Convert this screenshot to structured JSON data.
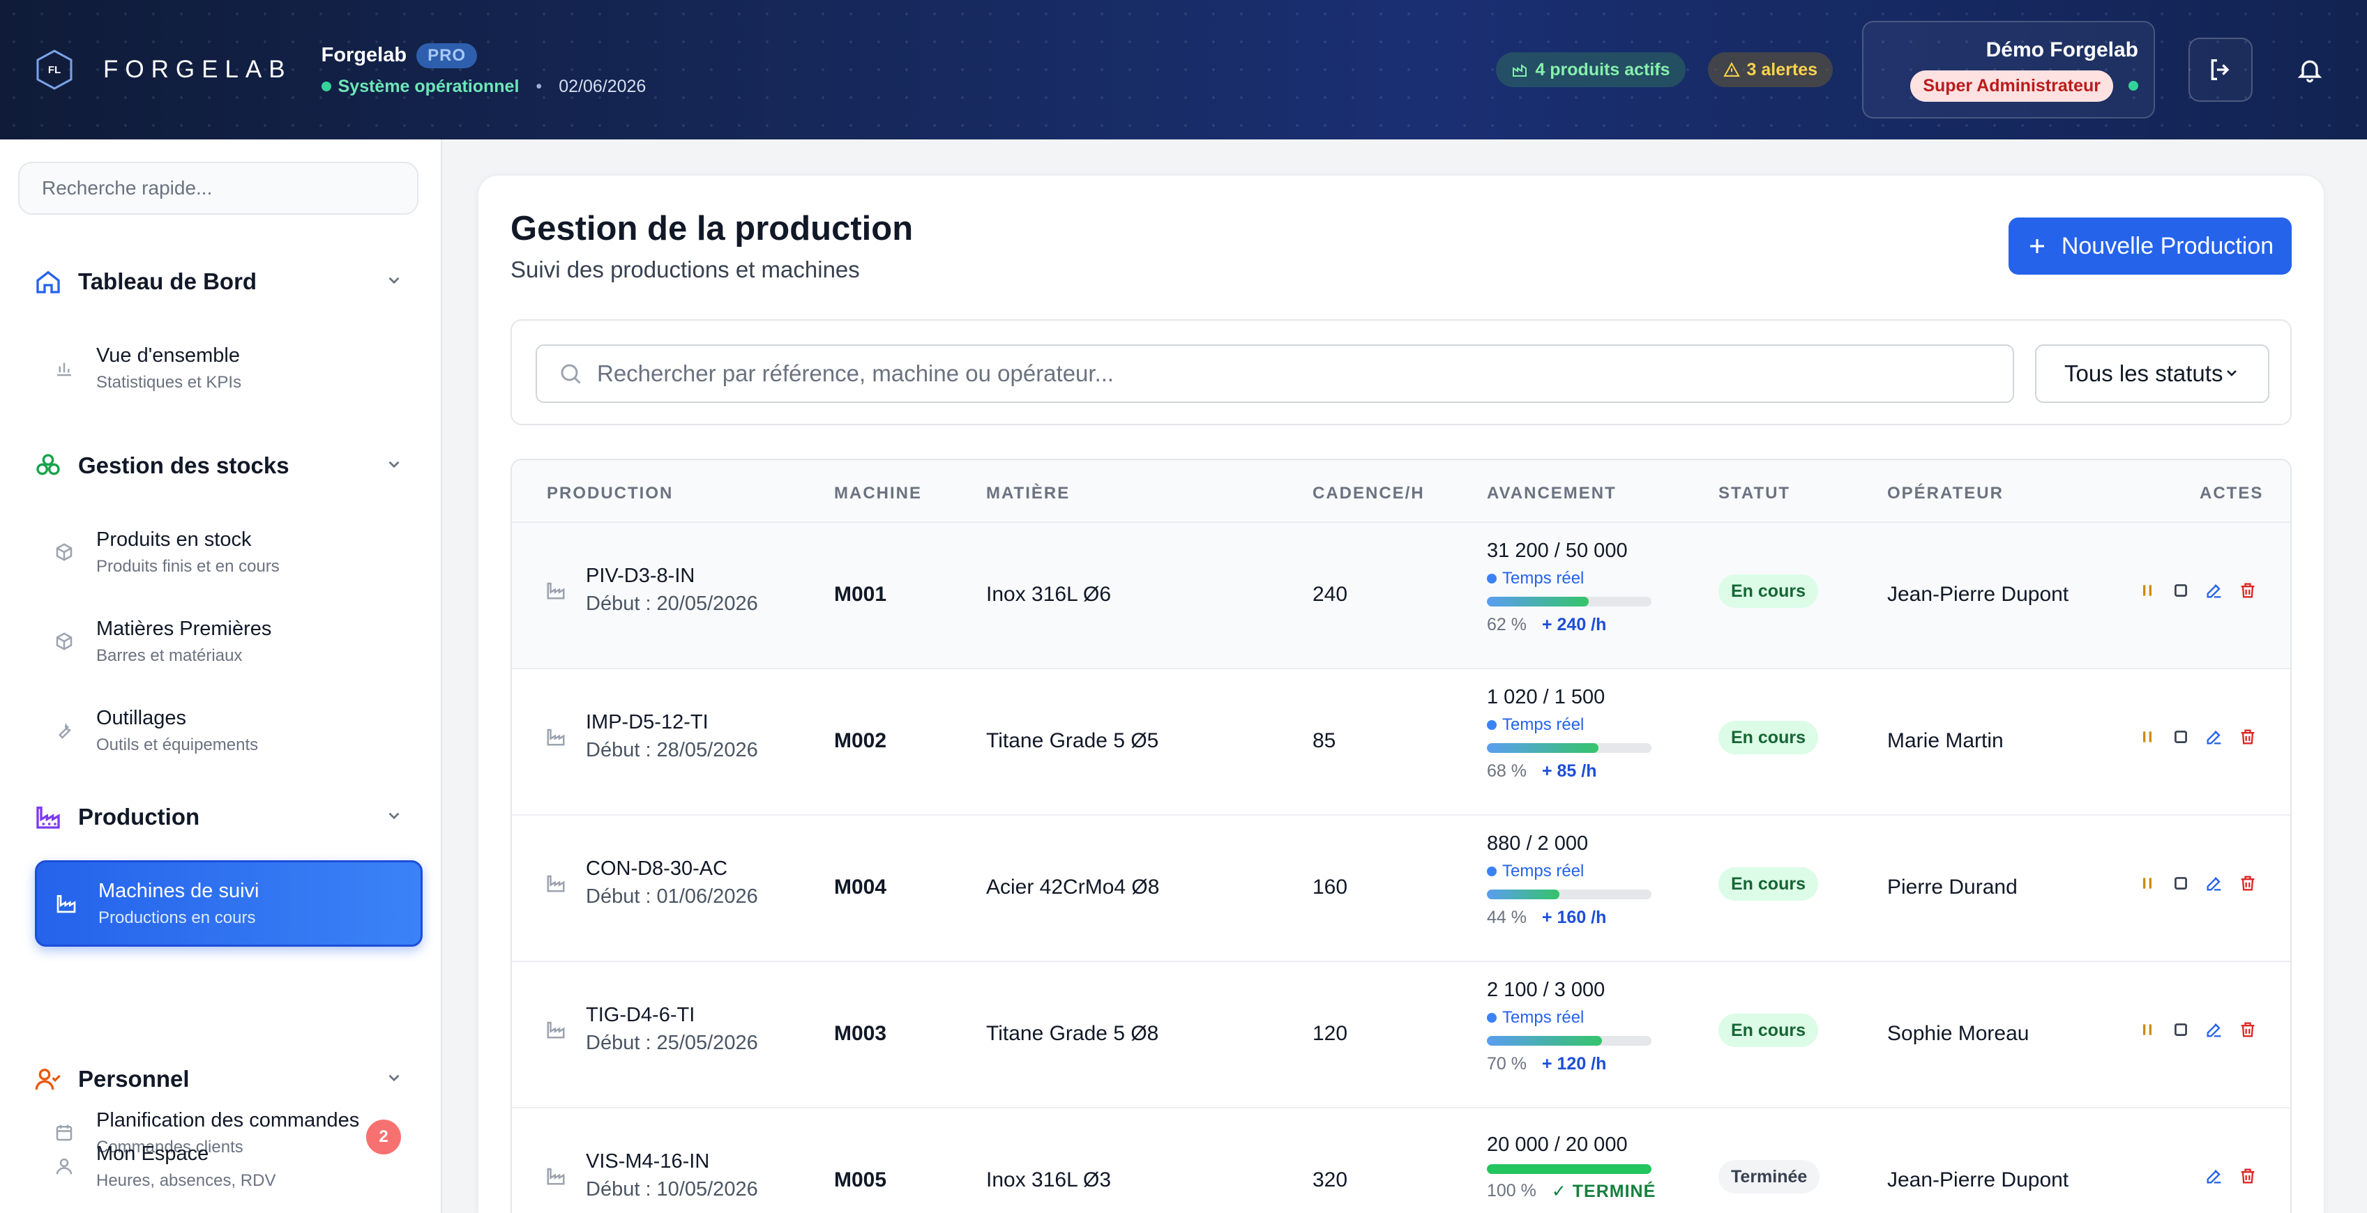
{
  "header": {
    "logo_mark": "FL",
    "logo_text": "FORGELAB",
    "org_name": "Forgelab",
    "plan_badge": "PRO",
    "system_status": "Système opérationnel",
    "separator": "•",
    "date": "02/06/2026",
    "active_products": "4 produits actifs",
    "alerts": "3 alertes",
    "user_name": "Démo Forgelab",
    "user_role": "Super Administrateur"
  },
  "sidebar": {
    "search_placeholder": "Recherche rapide...",
    "sections": [
      {
        "label": "Tableau de Bord",
        "icon": "home-icon",
        "color": "#2563eb"
      },
      {
        "label": "Gestion des stocks",
        "icon": "boxes-icon",
        "color": "#16a34a"
      },
      {
        "label": "Production",
        "icon": "factory-icon",
        "color": "#7c3aed"
      },
      {
        "label": "Personnel",
        "icon": "user-check-icon",
        "color": "#ea580c"
      }
    ],
    "items": [
      {
        "title": "Vue d'ensemble",
        "subtitle": "Statistiques et KPIs",
        "icon": "bar-chart-icon"
      },
      {
        "title": "Produits en stock",
        "subtitle": "Produits finis et en cours",
        "icon": "package-icon"
      },
      {
        "title": "Matières Premières",
        "subtitle": "Barres et matériaux",
        "icon": "package-icon"
      },
      {
        "title": "Outillages",
        "subtitle": "Outils et équipements",
        "icon": "wrench-icon"
      },
      {
        "title": "Machines de suivi",
        "subtitle": "Productions en cours",
        "icon": "factory-icon",
        "active": true
      },
      {
        "title": "Planification des commandes",
        "subtitle": "Commandes clients",
        "icon": "calendar-icon",
        "badge": "2"
      },
      {
        "title": "Mon Espace",
        "subtitle": "Heures, absences, RDV",
        "icon": "user-icon"
      }
    ]
  },
  "main": {
    "title": "Gestion de la production",
    "subtitle": "Suivi des productions et machines",
    "new_button": "Nouvelle Production",
    "search_placeholder": "Rechercher par référence, machine ou opérateur...",
    "status_filter": "Tous les statuts",
    "columns": [
      "PRODUCTION",
      "MACHINE",
      "MATIÈRE",
      "CADENCE/H",
      "AVANCEMENT",
      "STATUT",
      "OPÉRATEUR",
      "ACTES"
    ],
    "rows": [
      {
        "ref": "PIV-D3-8-IN",
        "start": "Début : 20/05/2026",
        "machine": "M001",
        "material": "Inox 316L Ø6",
        "rate": "240",
        "progress_text": "31 200 / 50 000",
        "realtime": "Temps réel",
        "percent": 62,
        "percent_text": "62 %",
        "rate_delta": "+ 240 /h",
        "status": "En cours",
        "operator": "Jean-Pierre Dupont"
      },
      {
        "ref": "IMP-D5-12-TI",
        "start": "Début : 28/05/2026",
        "machine": "M002",
        "material": "Titane Grade 5 Ø5",
        "rate": "85",
        "progress_text": "1 020 / 1 500",
        "realtime": "Temps réel",
        "percent": 68,
        "percent_text": "68 %",
        "rate_delta": "+ 85 /h",
        "status": "En cours",
        "operator": "Marie Martin"
      },
      {
        "ref": "CON-D8-30-AC",
        "start": "Début : 01/06/2026",
        "machine": "M004",
        "material": "Acier 42CrMo4 Ø8",
        "rate": "160",
        "progress_text": "880 / 2 000",
        "realtime": "Temps réel",
        "percent": 44,
        "percent_text": "44 %",
        "rate_delta": "+ 160 /h",
        "status": "En cours",
        "operator": "Pierre Durand"
      },
      {
        "ref": "TIG-D4-6-TI",
        "start": "Début : 25/05/2026",
        "machine": "M003",
        "material": "Titane Grade 5 Ø8",
        "rate": "120",
        "progress_text": "2 100 / 3 000",
        "realtime": "Temps réel",
        "percent": 70,
        "percent_text": "70 %",
        "rate_delta": "+ 120 /h",
        "status": "En cours",
        "operator": "Sophie Moreau"
      },
      {
        "ref": "VIS-M4-16-IN",
        "start": "Début : 10/05/2026",
        "machine": "M005",
        "material": "Inox 316L Ø3",
        "rate": "320",
        "progress_text": "20 000 / 20 000",
        "realtime": "",
        "percent": 100,
        "percent_text": "100 %",
        "rate_delta": "✓ TERMINÉ",
        "status": "Terminée",
        "operator": "Jean-Pierre Dupont"
      }
    ]
  }
}
